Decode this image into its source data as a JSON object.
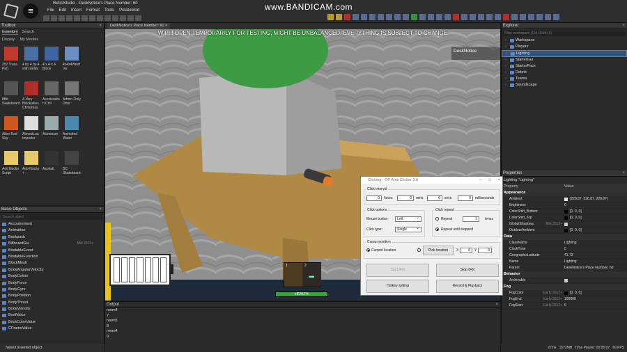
{
  "app": {
    "title": "RetroStudio - DeskNotice's Place Number: 60",
    "menus": [
      "File",
      "Edit",
      "Insert",
      "Format",
      "Tools",
      "PotatoMod"
    ]
  },
  "watermark": "www.BANDICAM.com",
  "toolbox": {
    "title": "Toolbox",
    "tabs": [
      "Inventory",
      "Search"
    ],
    "display_label": "Display:",
    "display_value": "My Models",
    "items": [
      {
        "label": "2x2 Truss Part",
        "color": "#c0392b"
      },
      {
        "label": "4 by 4 by 4 with welds",
        "color": "#4a6fa5"
      },
      {
        "label": "4 x 4 x 4 Block",
        "color": "#3f66a0"
      },
      {
        "label": "4x4x4Wind ow",
        "color": "#6b8fc2"
      },
      {
        "label": "",
        "color": "#2a2a2a"
      },
      {
        "label": "8Bit Skateboard",
        "color": "#555"
      },
      {
        "label": "A Very Blocklakes Christmas",
        "color": "#b03030"
      },
      {
        "label": "Acceleratio n Coil",
        "color": "#666"
      },
      {
        "label": "Admin Only Door",
        "color": "#777"
      },
      {
        "label": "",
        "color": "#2a2a2a"
      },
      {
        "label": "Alien Red Sky",
        "color": "#d0571c"
      },
      {
        "label": "AlmostLua Importer",
        "color": "#ddd"
      },
      {
        "label": "Aluminum",
        "color": "#9aa"
      },
      {
        "label": "Animated Water",
        "color": "#4a8ab0"
      },
      {
        "label": "",
        "color": "#2a2a2a"
      },
      {
        "label": "Anti Noclip Script",
        "color": "#e8c96a"
      },
      {
        "label": "Anti-Noclip +",
        "color": "#e8c96a"
      },
      {
        "label": "Asphalt",
        "color": "#333"
      },
      {
        "label": "BC Skateboard",
        "color": "#444"
      },
      {
        "label": "",
        "color": "#2a2a2a"
      }
    ]
  },
  "basic_objects": {
    "title": "Basic Objects",
    "search_placeholder": "Search object",
    "items": [
      {
        "label": "Accoutrement",
        "hint": ""
      },
      {
        "label": "Animation",
        "hint": ""
      },
      {
        "label": "Backpack",
        "hint": ""
      },
      {
        "label": "BillboardGui",
        "hint": "Mid 2013+"
      },
      {
        "label": "BindableEvent",
        "hint": ""
      },
      {
        "label": "BindableFunction",
        "hint": ""
      },
      {
        "label": "BlockMesh",
        "hint": ""
      },
      {
        "label": "BodyAngularVelocity",
        "hint": ""
      },
      {
        "label": "BodyColors",
        "hint": ""
      },
      {
        "label": "BodyForce",
        "hint": ""
      },
      {
        "label": "BodyGyro",
        "hint": ""
      },
      {
        "label": "BodyPosition",
        "hint": ""
      },
      {
        "label": "BodyThrust",
        "hint": ""
      },
      {
        "label": "BodyVelocity",
        "hint": ""
      },
      {
        "label": "BoolValue",
        "hint": ""
      },
      {
        "label": "BrickColorValue",
        "hint": ""
      },
      {
        "label": "CFrameValue",
        "hint": ""
      }
    ],
    "select_inserted": "Select inserted object"
  },
  "doc_tab": "DeskNotice's Place Number: 60",
  "viewport": {
    "banner": "WIP!!! OPEN TEMPORARILY FOR TESTING, MIGHT BE UNBALANCED, EVERYTHING IS SUBJECT TO CHANGE",
    "player_name": "DeskNotice",
    "hotbar_slots": [
      "1",
      "2"
    ],
    "health_label": "HEALTH"
  },
  "output": {
    "title": "Output",
    "lines": [
      "room4",
      "7",
      "room5",
      "8",
      "room4",
      "9"
    ]
  },
  "explorer": {
    "title": "Explorer",
    "filter_placeholder": "Filter workspace (Ctrl+Shift+X)",
    "items": [
      {
        "label": "Workspace",
        "selected": false
      },
      {
        "label": "Players",
        "selected": false
      },
      {
        "label": "Lighting",
        "selected": true
      },
      {
        "label": "StarterGui",
        "selected": false
      },
      {
        "label": "StarterPack",
        "selected": false
      },
      {
        "label": "Debris",
        "selected": false
      },
      {
        "label": "Teams",
        "selected": false
      },
      {
        "label": "Soundscape",
        "selected": false
      }
    ]
  },
  "properties": {
    "title": "Properties",
    "subtitle": "Lighting \"Lighting\"",
    "col_property": "Property",
    "col_value": "Value",
    "sections": [
      {
        "name": "Appearance",
        "rows": [
          {
            "k": "Ambient",
            "v": "[228.87, 228.87, 228.87]",
            "swatch": "#e4e4e4",
            "hint": ""
          },
          {
            "k": "Brightness",
            "v": "0",
            "swatch": "",
            "hint": ""
          },
          {
            "k": "ColorShift_Bottom",
            "v": "[0, 0, 0]",
            "swatch": "#000000",
            "hint": ""
          },
          {
            "k": "ColorShift_Top",
            "v": "[0, 0, 0]",
            "swatch": "#000000",
            "hint": ""
          },
          {
            "k": "GlobalShadows",
            "v": "",
            "swatch": "#cccccc",
            "hint": "Mid 2013+"
          },
          {
            "k": "OutdoorAmbient",
            "v": "[0, 0, 0]",
            "swatch": "#000000",
            "hint": ""
          }
        ]
      },
      {
        "name": "Data",
        "rows": [
          {
            "k": "ClassName",
            "v": "Lighting",
            "swatch": "",
            "hint": ""
          },
          {
            "k": "ClockTime",
            "v": "0",
            "swatch": "",
            "hint": ""
          },
          {
            "k": "GeographicLatitude",
            "v": "41.73",
            "swatch": "",
            "hint": ""
          },
          {
            "k": "Name",
            "v": "Lighting",
            "swatch": "",
            "hint": ""
          },
          {
            "k": "Parent",
            "v": "DeskNotice's Place Number: 60",
            "swatch": "",
            "hint": ""
          }
        ]
      },
      {
        "name": "Behavior",
        "rows": [
          {
            "k": "Archivable",
            "v": "",
            "swatch": "#cccccc",
            "hint": ""
          }
        ]
      },
      {
        "name": "Fog",
        "rows": [
          {
            "k": "FogColor",
            "v": "[0, 0, 0]",
            "swatch": "#000000",
            "hint": "Early 2012+"
          },
          {
            "k": "FogEnd",
            "v": "100000",
            "swatch": "",
            "hint": "Early 2012+"
          },
          {
            "k": "FogStart",
            "v": "0",
            "swatch": "",
            "hint": "Early 2012+"
          }
        ]
      }
    ]
  },
  "statusbar": {
    "ms": "27ms",
    "mb": "1572MB",
    "time_played": "Time Played: 00:05:07",
    "fps": "60 FPS"
  },
  "clicker": {
    "title": "Clicking - OP Auto Clicker 3.0",
    "interval_label": "Click interval",
    "hours": "0",
    "hours_label": "hours",
    "mins": "0",
    "mins_label": "mins",
    "secs": "0",
    "secs_label": "secs",
    "ms": "0",
    "ms_label": "milliseconds",
    "options_label": "Click options",
    "mouse_button_label": "Mouse button:",
    "mouse_button_value": "Left",
    "click_type_label": "Click type:",
    "click_type_value": "Single",
    "repeat_group_label": "Click repeat",
    "repeat_label": "Repeat",
    "repeat_times": "1",
    "times_label": "times",
    "repeat_until_label": "Repeat until stopped",
    "cursor_label": "Cursor position",
    "current_location_label": "Current location",
    "pick_location_label": "Pick location",
    "x_label": "X",
    "x_value": "0",
    "y_label": "Y",
    "y_value": "0",
    "start_label": "Start (F6)",
    "stop_label": "Stop (F6)",
    "hotkey_label": "Hotkey setting",
    "record_label": "Record & Playback"
  }
}
